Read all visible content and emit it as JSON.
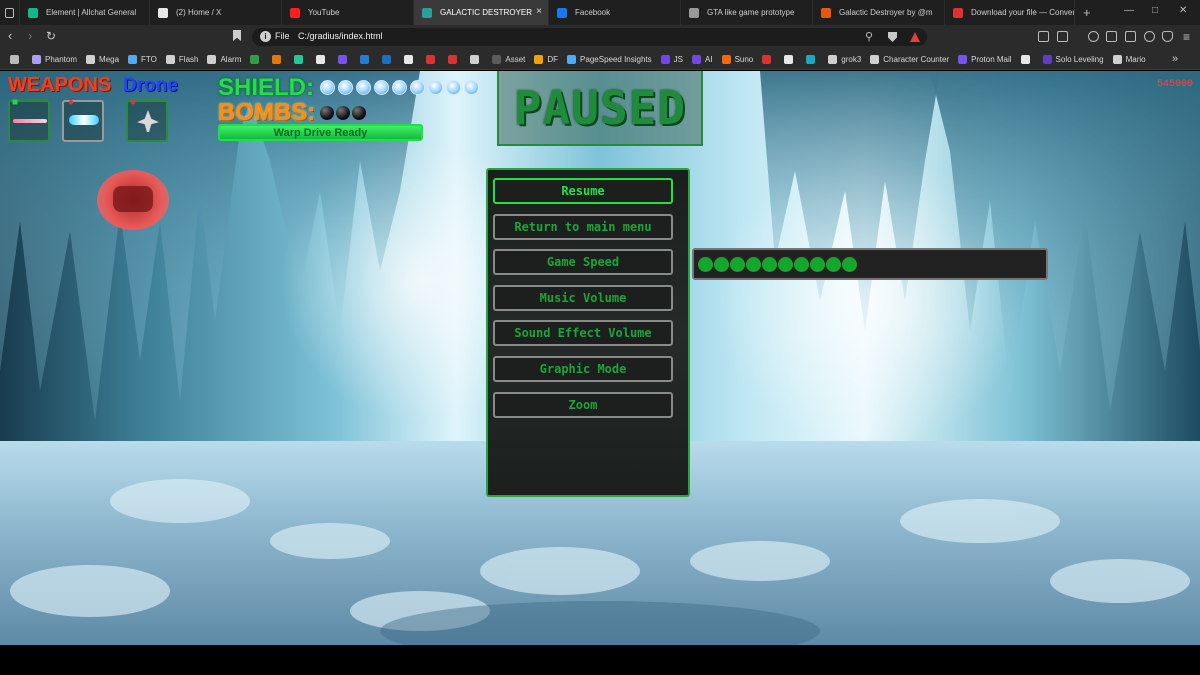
{
  "browser": {
    "tabs": [
      {
        "title": "Element | Allchat General",
        "color": "#12b886"
      },
      {
        "title": "(2) Home / X",
        "color": "#e8e8e8"
      },
      {
        "title": "YouTube",
        "color": "#ff1f1f"
      },
      {
        "title": "GALACTIC DESTROYER",
        "color": "#2aa198",
        "active": true
      },
      {
        "title": "Facebook",
        "color": "#1877f2"
      },
      {
        "title": "GTA like game prototype",
        "color": "#9a9a9a"
      },
      {
        "title": "Galactic Destroyer by @m",
        "color": "#e8590c"
      },
      {
        "title": "Download your file — Convert",
        "color": "#e03131"
      }
    ],
    "tab_close": "×",
    "new_tab": "+",
    "address_scheme": "File",
    "address_url": "C:/gradius/index.html",
    "bookmarks": [
      {
        "label": "",
        "color": "#bbbbbb"
      },
      {
        "label": "Phantom",
        "color": "#ab9ff2"
      },
      {
        "label": "Mega",
        "color": "#cfcfcf"
      },
      {
        "label": "FTO",
        "color": "#4dabf7"
      },
      {
        "label": "Flash",
        "color": "#cfcfcf"
      },
      {
        "label": "Alarm",
        "color": "#cfcfcf"
      },
      {
        "label": "",
        "color": "#2f9e44"
      },
      {
        "label": "",
        "color": "#e67700"
      },
      {
        "label": "",
        "color": "#20c997"
      },
      {
        "label": "",
        "color": "#e8e8e8"
      },
      {
        "label": "",
        "color": "#7950f2"
      },
      {
        "label": "",
        "color": "#1c7ed6"
      },
      {
        "label": "",
        "color": "#1971c2"
      },
      {
        "label": "",
        "color": "#e8e8e8"
      },
      {
        "label": "",
        "color": "#e03131"
      },
      {
        "label": "",
        "color": "#e03131"
      },
      {
        "label": "",
        "color": "#cfcfcf"
      },
      {
        "label": "Asset",
        "color": "#5c5c5c"
      },
      {
        "label": "DF",
        "color": "#f59f00"
      },
      {
        "label": "PageSpeed Insights",
        "color": "#4dabf7"
      },
      {
        "label": "JS",
        "color": "#7048e8"
      },
      {
        "label": "AI",
        "color": "#7048e8"
      },
      {
        "label": "Suno",
        "color": "#f76707"
      },
      {
        "label": "",
        "color": "#e03131"
      },
      {
        "label": "",
        "color": "#e8e8e8"
      },
      {
        "label": "",
        "color": "#15aabf"
      },
      {
        "label": "grok3",
        "color": "#cfcfcf"
      },
      {
        "label": "Character Counter",
        "color": "#cfcfcf"
      },
      {
        "label": "Proton Mail",
        "color": "#7950f2"
      },
      {
        "label": "",
        "color": "#e8e8e8"
      },
      {
        "label": "Solo Leveling",
        "color": "#5f3dc4"
      },
      {
        "label": "Mario",
        "color": "#cfcfcf"
      }
    ],
    "bookmarks_more": "»"
  },
  "hud": {
    "weapons_label": "WEAPONS",
    "drone_label": "Drone",
    "shield_label": "SHIELD:",
    "shield_orbs": 9,
    "bombs_label": "BOMBS:",
    "bombs": 3,
    "warp_label": "Warp Drive Ready",
    "warp_level": 1.0,
    "score": "545000"
  },
  "pause_menu": {
    "title": "PAUSED",
    "items": [
      {
        "label": "Resume",
        "selected": true
      },
      {
        "label": "Return to main menu"
      },
      {
        "label": "Game Speed"
      },
      {
        "label": "Music Volume"
      },
      {
        "label": "Sound Effect Volume"
      },
      {
        "label": "Graphic Mode"
      },
      {
        "label": "Zoom"
      }
    ]
  },
  "game_speed": {
    "dots": 10,
    "max": 20
  },
  "colors": {
    "hud_green": "#1ee245",
    "menu_green": "#1da43a",
    "weapons_red": "#ff3a1a",
    "drone_blue": "#2244ff",
    "bombs_orange": "#ff8a1a",
    "score_red": "#ff4040"
  }
}
